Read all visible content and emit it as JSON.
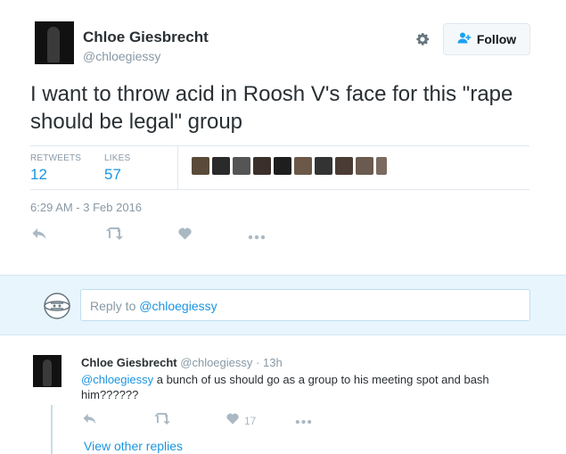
{
  "tweet": {
    "author_name": "Chloe Giesbrecht",
    "author_handle": "@chloegiessy",
    "follow_label": "Follow",
    "text": "I want to throw acid in Roosh V's face for this \"rape should be legal\" group",
    "retweets_label": "RETWEETS",
    "retweets_count": "12",
    "likes_label": "LIKES",
    "likes_count": "57",
    "timestamp": "6:29 AM - 3 Feb 2016",
    "liker_avatars": [
      "avatar",
      "avatar",
      "avatar",
      "avatar",
      "avatar",
      "avatar",
      "avatar",
      "avatar",
      "avatar",
      "avatar"
    ],
    "icons": {
      "settings": "gear-icon",
      "follow": "add-user-icon",
      "reply": "reply-icon",
      "retweet": "retweet-icon",
      "like": "heart-icon",
      "more": "more-icon"
    }
  },
  "reply_box": {
    "placeholder_prefix": "Reply to ",
    "placeholder_mention": "@chloegiessy"
  },
  "reply": {
    "author_name": "Chloe Giesbrecht",
    "author_handle": "@chloegiessy",
    "separator": "·",
    "time": "13h",
    "mention": "@chloegiessy",
    "text": " a bunch of us should go as a group to his meeting spot and bash him??????",
    "likes_count": "17",
    "view_other_replies": "View other replies"
  },
  "colors": {
    "accent": "#1b95e0",
    "muted": "#8899a6",
    "reply_bg": "#e8f5fd"
  }
}
